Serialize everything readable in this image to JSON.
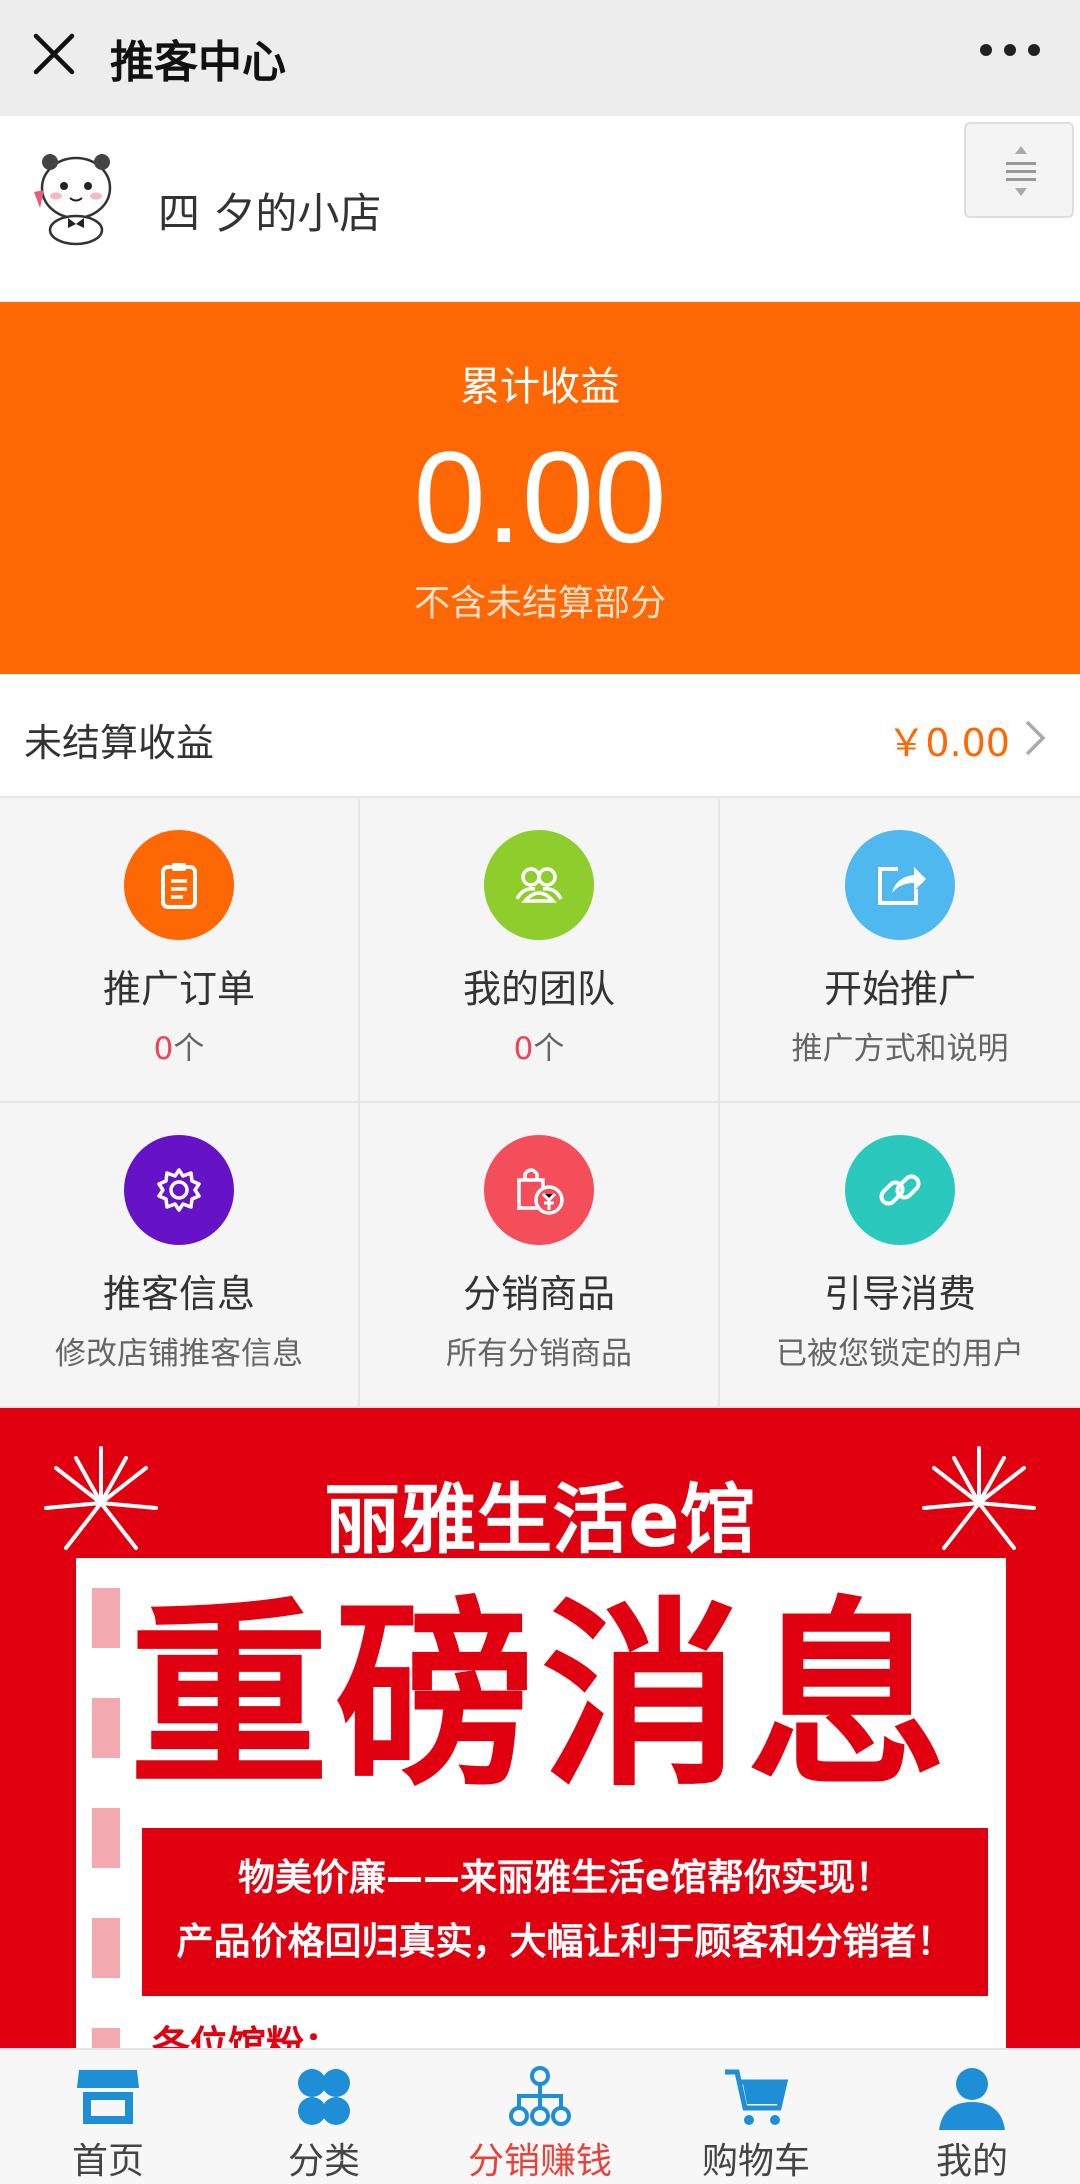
{
  "topbar": {
    "title": "推客中心",
    "close_icon": "close-icon",
    "more_icon": "more-icon"
  },
  "shop": {
    "name": "四 夕的小店"
  },
  "earnings": {
    "label": "累计收益",
    "value": "0.00",
    "note": "不含未结算部分"
  },
  "unsettled": {
    "label": "未结算收益",
    "value": "￥0.00"
  },
  "grid": [
    {
      "name": "推广订单",
      "count": "0",
      "unit": "个",
      "color": "#fe6804",
      "icon": "clipboard-icon"
    },
    {
      "name": "我的团队",
      "count": "0",
      "unit": "个",
      "color": "#8fcd2c",
      "icon": "team-icon"
    },
    {
      "name": "开始推广",
      "sub": "推广方式和说明",
      "color": "#4fb8ef",
      "icon": "share-icon"
    },
    {
      "name": "推客信息",
      "sub": "修改店铺推客信息",
      "color": "#6612c7",
      "icon": "gear-icon"
    },
    {
      "name": "分销商品",
      "sub": "所有分销商品",
      "color": "#f44e5b",
      "icon": "shopping-bag-icon"
    },
    {
      "name": "引导消费",
      "sub": "已被您锁定的用户",
      "color": "#2bc9bd",
      "icon": "link-icon"
    }
  ],
  "banner": {
    "brand": "丽雅生活e馆",
    "headline": "重磅消息",
    "line1": "物美价廉——来丽雅生活e馆帮你实现！",
    "line2": "产品价格回归真实，大幅让利于顾客和分销者！",
    "greeting": "各位馆粉："
  },
  "tabs": [
    {
      "label": "首页",
      "icon": "store-icon",
      "active": false
    },
    {
      "label": "分类",
      "icon": "category-icon",
      "active": false
    },
    {
      "label": "分销赚钱",
      "icon": "distribution-icon",
      "active": true
    },
    {
      "label": "购物车",
      "icon": "cart-icon",
      "active": false
    },
    {
      "label": "我的",
      "icon": "user-icon",
      "active": false
    }
  ],
  "colors": {
    "accent": "#fe6804",
    "tab_icon": "#1e8fd6",
    "tab_active": "#e9423a",
    "banner_red": "#e0000f"
  }
}
